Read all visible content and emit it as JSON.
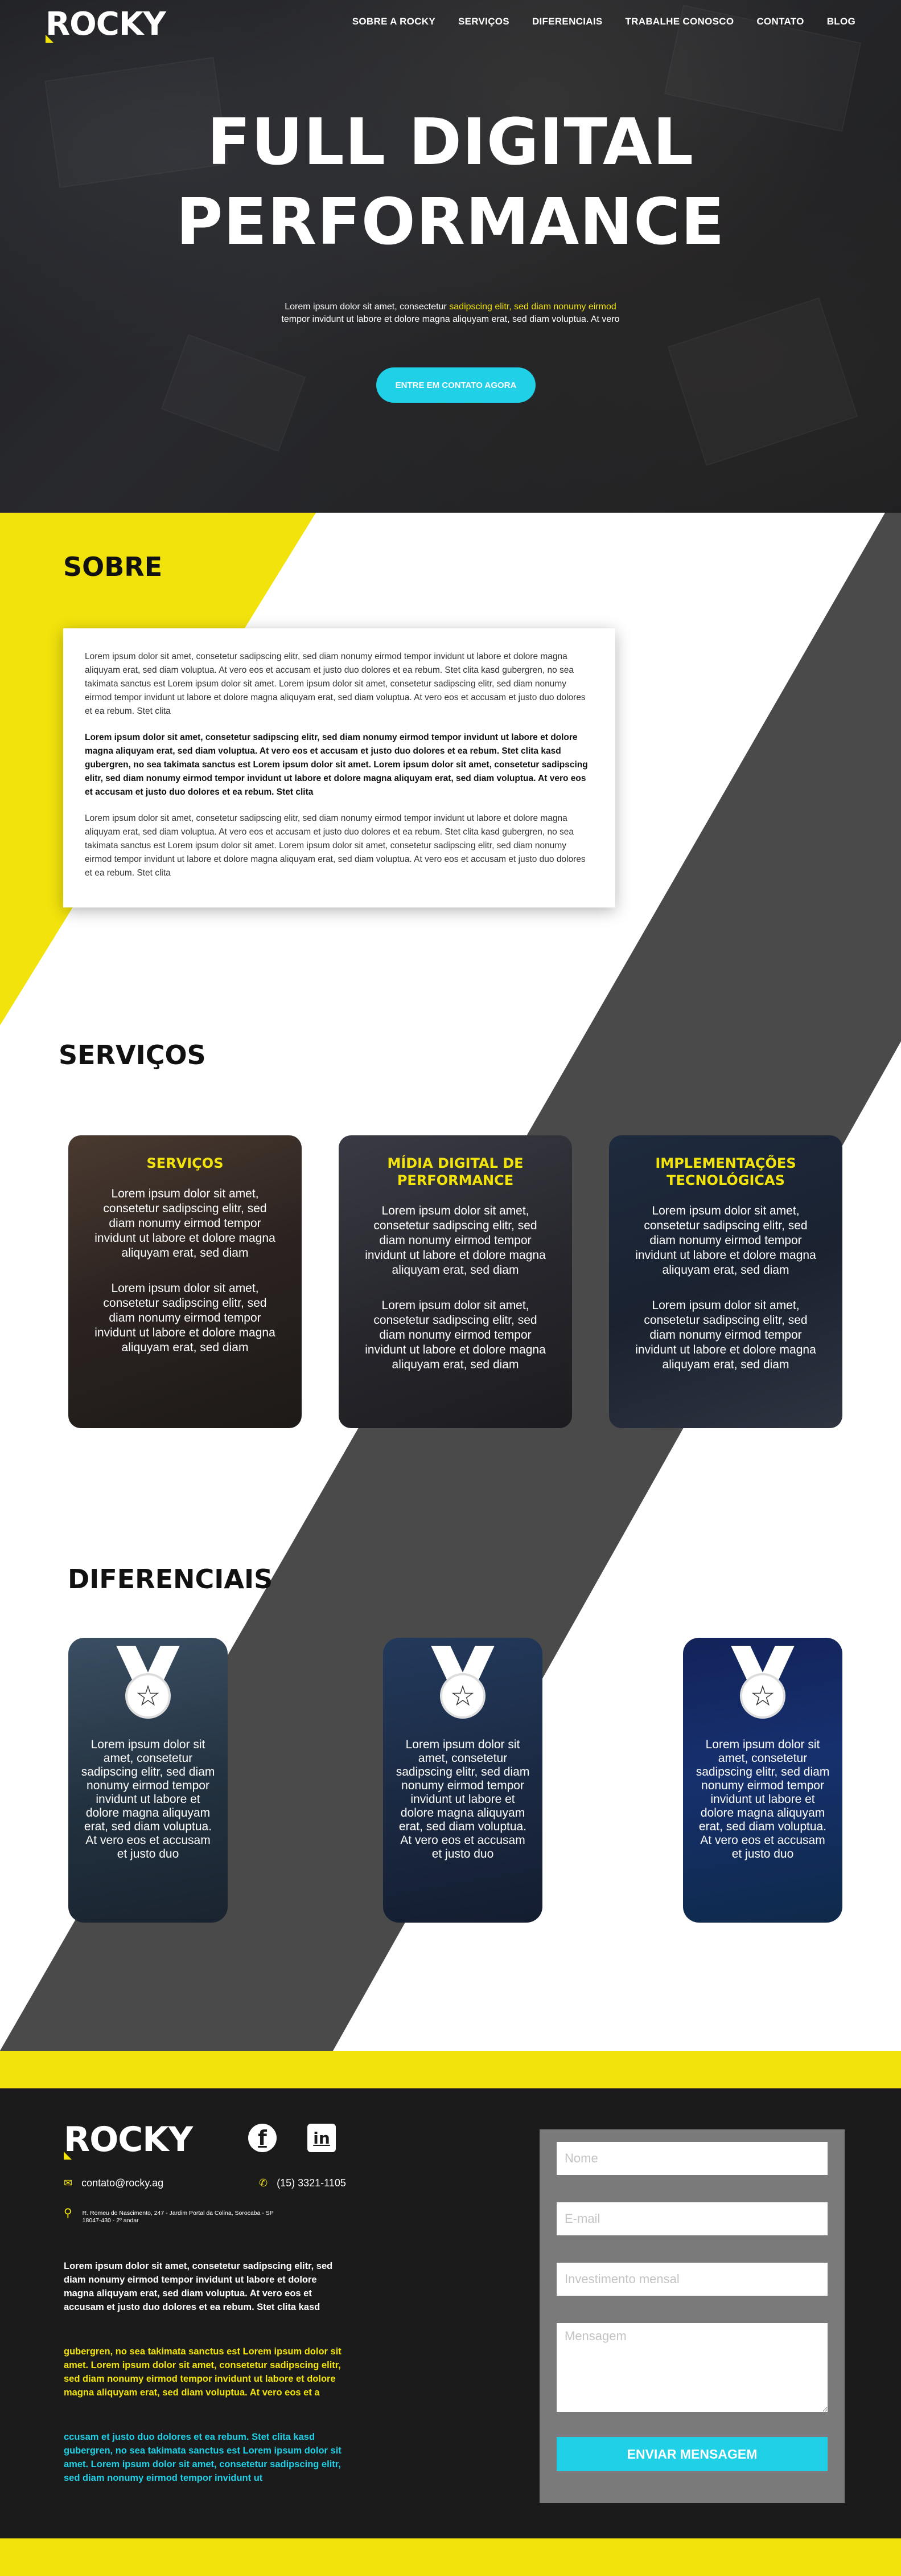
{
  "brand": {
    "logo_text": "ROCKY"
  },
  "nav": {
    "items": [
      "SOBRE A ROCKY",
      "SERVIÇOS",
      "DIFERENCIAIS",
      "TRABALHE CONOSCO",
      "CONTATO",
      "BLOG"
    ]
  },
  "hero": {
    "title_line1": "FULL DIGITAL",
    "title_line2": "PERFORMANCE",
    "subtitle_part1": "Lorem ipsum dolor sit amet, consectetur ",
    "subtitle_highlight": "sadipscing elitr, sed diam nonumy eirmod",
    "subtitle_line2": "tempor invidunt ut labore et dolore magna aliquyam erat, sed diam voluptua. At vero",
    "cta_label": "ENTRE EM CONTATO AGORA"
  },
  "sobre": {
    "title": "SOBRE",
    "paragraph1": "Lorem ipsum dolor sit amet, consetetur sadipscing elitr, sed diam nonumy eirmod tempor invidunt ut labore et dolore magna aliquyam erat, sed diam voluptua. At vero eos et accusam et justo duo dolores et ea rebum. Stet clita kasd gubergren, no sea takimata sanctus est Lorem ipsum dolor sit amet. Lorem ipsum dolor sit amet, consetetur sadipscing elitr, sed diam nonumy eirmod tempor invidunt ut labore et dolore magna aliquyam erat, sed diam voluptua. At vero eos et accusam et justo duo dolores et ea rebum. Stet clita",
    "paragraph2": "Lorem ipsum dolor sit amet, consetetur sadipscing elitr, sed diam nonumy eirmod tempor invidunt ut labore et dolore magna aliquyam erat, sed diam voluptua. At vero eos et accusam et justo duo dolores et ea rebum. Stet clita kasd gubergren, no sea takimata sanctus est Lorem ipsum dolor sit amet. Lorem ipsum dolor sit amet, consetetur sadipscing elitr, sed diam nonumy eirmod tempor invidunt ut labore et dolore magna aliquyam erat, sed diam voluptua. At vero eos et accusam et justo duo dolores et ea rebum. Stet clita",
    "paragraph3": "Lorem ipsum dolor sit amet, consetetur sadipscing elitr, sed diam nonumy eirmod tempor invidunt ut labore et dolore magna aliquyam erat, sed diam voluptua. At vero eos et accusam et justo duo dolores et ea rebum. Stet clita kasd gubergren, no sea takimata sanctus est Lorem ipsum dolor sit amet. Lorem ipsum dolor sit amet, consetetur sadipscing elitr, sed diam nonumy eirmod tempor invidunt ut labore et dolore magna aliquyam erat, sed diam voluptua. At vero eos et accusam et justo duo dolores et ea rebum. Stet clita"
  },
  "servicos": {
    "title": "SERVIÇOS",
    "cards": [
      {
        "title": "SERVIÇOS",
        "text1": "Lorem ipsum dolor sit amet, consetetur sadipscing elitr, sed diam nonumy eirmod tempor invidunt ut labore et dolore magna aliquyam erat, sed diam",
        "text2": "Lorem ipsum dolor sit amet, consetetur sadipscing elitr, sed diam nonumy eirmod tempor invidunt ut labore et dolore magna aliquyam erat, sed diam"
      },
      {
        "title": "MÍDIA DIGITAL DE PERFORMANCE",
        "text1": "Lorem ipsum dolor sit amet, consetetur sadipscing elitr, sed diam nonumy eirmod tempor invidunt ut labore et dolore magna aliquyam erat, sed diam",
        "text2": "Lorem ipsum dolor sit amet, consetetur sadipscing elitr, sed diam nonumy eirmod tempor invidunt ut labore et dolore magna aliquyam erat, sed diam"
      },
      {
        "title": "IMPLEMENTAÇÕES TECNOLÓGICAS",
        "text1": "Lorem ipsum dolor sit amet, consetetur sadipscing elitr, sed diam nonumy eirmod tempor invidunt ut labore et dolore magna aliquyam erat, sed diam",
        "text2": "Lorem ipsum dolor sit amet, consetetur sadipscing elitr, sed diam nonumy eirmod tempor invidunt ut labore et dolore magna aliquyam erat, sed diam"
      }
    ]
  },
  "diferenciais": {
    "title": "DIFERENCIAIS",
    "cards": [
      {
        "text": "Lorem ipsum dolor sit amet, consetetur sadipscing elitr, sed diam nonumy eirmod tempor invidunt ut labore et dolore magna aliquyam erat, sed diam voluptua. At vero eos et accusam et justo duo"
      },
      {
        "text": "Lorem ipsum dolor sit amet, consetetur sadipscing elitr, sed diam nonumy eirmod tempor invidunt ut labore et dolore magna aliquyam erat, sed diam voluptua. At vero eos et accusam et justo duo"
      },
      {
        "text": "Lorem ipsum dolor sit amet, consetetur sadipscing elitr, sed diam nonumy eirmod tempor invidunt ut labore et dolore magna aliquyam erat, sed diam voluptua. At vero eos et accusam et justo duo"
      }
    ]
  },
  "footer": {
    "email": "contato@rocky.ag",
    "phone": "(15) 3321-1105",
    "address_line1": "R. Romeu do Nascimento, 247 - Jardim Portal da Colina, Sorocaba - SP",
    "address_line2": "18047-430 - 2º andar",
    "text_white": "Lorem ipsum dolor sit amet, consetetur sadipscing elitr, sed diam nonumy eirmod tempor invidunt ut labore et dolore magna aliquyam erat, sed diam voluptua. At vero eos et accusam et justo duo dolores et ea rebum. Stet clita kasd",
    "text_yellow": "gubergren, no sea takimata sanctus est Lorem ipsum dolor sit amet. Lorem ipsum dolor sit amet, consetetur sadipscing elitr, sed diam nonumy eirmod tempor invidunt ut labore et dolore magna aliquyam erat, sed diam voluptua. At vero eos et a",
    "text_cyan": "ccusam et justo duo dolores et ea rebum. Stet clita kasd gubergren, no sea takimata sanctus est Lorem ipsum dolor sit amet. Lorem ipsum dolor sit amet, consetetur sadipscing elitr, sed diam nonumy eirmod tempor invidunt ut",
    "form": {
      "name_placeholder": "Nome",
      "email_placeholder": "E-mail",
      "budget_placeholder": "Investimento mensal",
      "message_placeholder": "Mensagem",
      "submit_label": "ENVIAR MENSAGEM"
    }
  },
  "icons": {
    "email": "envelope-icon",
    "phone": "phone-icon",
    "address": "map-pin-icon",
    "facebook": "facebook-icon",
    "linkedin": "linkedin-icon",
    "medal": "medal-star-icon"
  },
  "colors": {
    "accent_yellow": "#f2e30c",
    "accent_cyan": "#1fd0e6",
    "diagonal_gray": "#4a4a4a",
    "footer_bg": "#1b1b1b",
    "form_bg": "#7a7a7a"
  }
}
